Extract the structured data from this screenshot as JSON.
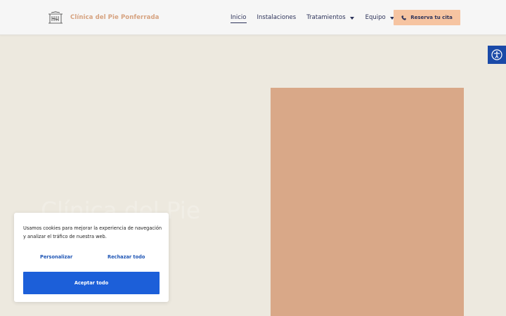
{
  "header": {
    "brand_name": "Clínica del Pie Ponferrada",
    "logo_icon": "clinic-building-logo-icon",
    "nav": [
      {
        "label": "Inicio",
        "active": true,
        "has_dropdown": false
      },
      {
        "label": "Instalaciones",
        "active": false,
        "has_dropdown": false
      },
      {
        "label": "Tratamientos",
        "active": false,
        "has_dropdown": true
      },
      {
        "label": "Equipo",
        "active": false,
        "has_dropdown": true
      }
    ],
    "cta": {
      "label": "Reserva tu cita",
      "icon": "phone-icon"
    }
  },
  "hero": {
    "heading": "Clínica del Pie Ponferrada"
  },
  "accessibility": {
    "icon": "accessibility-person-icon"
  },
  "cookie": {
    "text": "Usamos cookies para mejorar la experiencia de navegación y analizar el tráfico de nuestra web.",
    "personalize_label": "Personalizar",
    "reject_label": "Rechazar todo",
    "accept_label": "Aceptar todo"
  },
  "colors": {
    "page_bg": "#ede9df",
    "header_bg": "#f6f6f6",
    "brand_text": "#d6a27f",
    "nav_text": "#2d335a",
    "cta_bg": "#f6c4a1",
    "hero_block": "#d9a888",
    "a11y_bg": "#1a4aa8",
    "link_blue": "#1e55b5",
    "accept_bg": "#1c5fd9"
  }
}
